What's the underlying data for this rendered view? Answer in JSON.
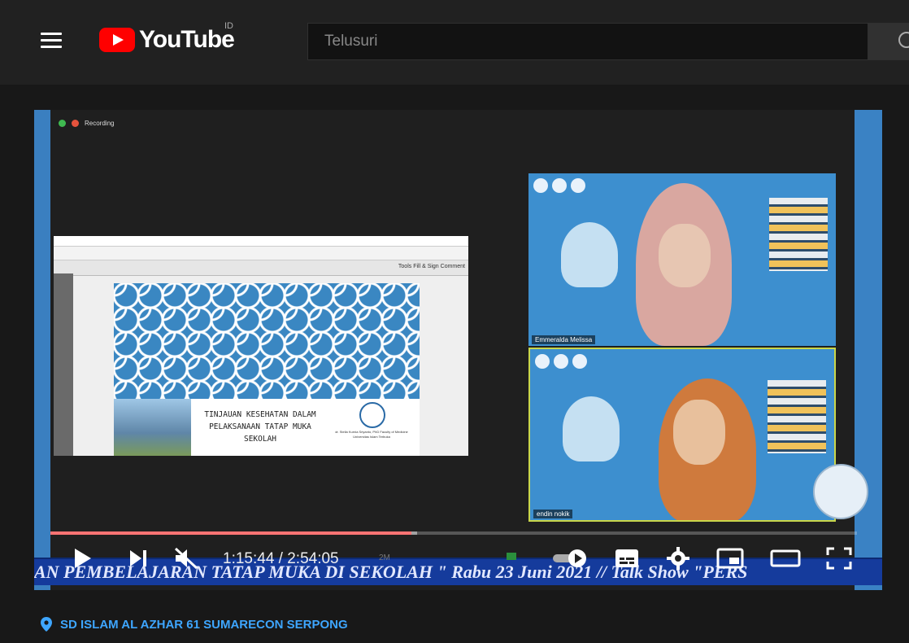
{
  "header": {
    "logo_text": "YouTube",
    "country_code": "ID",
    "search_placeholder": "Telusuri"
  },
  "video": {
    "recording_label": "Recording",
    "shared_toolbar_right": "Tools   Fill & Sign   Comment",
    "slide_title": "TINJAUAN KESEHATAN DALAM PELAKSANAAN TATAP MUKA SEKOLAH",
    "slide_author": "dr. Stella Kurnia Sriyanto, PhD Faculty of Medicine Universitas Islam Terbuka",
    "participants": [
      {
        "name": "Emmeralda Melissa"
      },
      {
        "name": "endin nokik"
      }
    ],
    "ticker_text": "AN PEMBELAJARAN TATAP MUKA DI SEKOLAH \" Rabu 23 Juni 2021   // Talk Show \"PERS",
    "progress_fraction": 0.4475,
    "buffered_fraction": 0.455
  },
  "controls": {
    "time_display": "1:15:44 / 2:54:05",
    "viewer_badge": "2M"
  },
  "location": {
    "label": "SD ISLAM AL AZHAR 61 SUMARECON SERPONG"
  },
  "colors": {
    "accent": "#ff0000",
    "location_text": "#3ea6ff",
    "ticker_bg": "#153b9c"
  }
}
